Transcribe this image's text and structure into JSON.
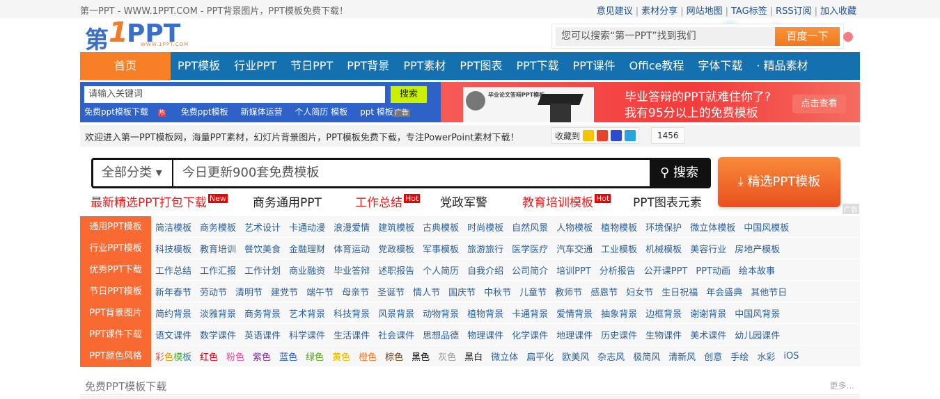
{
  "topbar": {
    "title": "第一PPT - WWW.1PPT.COM - PPT背景图片，PPT模板免费下载！",
    "links": [
      "意见建议",
      "素材分享",
      "网站地图",
      "TAG标签",
      "RSS订阅",
      "加入收藏"
    ]
  },
  "logo": {
    "a": "第",
    "b": "1",
    "c": "PPT",
    "url": "WWW.1PPT.COM"
  },
  "baidu": {
    "placeholder": "您可以搜索“第一PPT”找到我们",
    "button": "百度一下"
  },
  "nav": [
    "首页",
    "PPT模板",
    "行业PPT",
    "节日PPT",
    "PPT背景",
    "PPT素材",
    "PPT图表",
    "PPT下载",
    "PPT课件",
    "Office教程",
    "字体下载",
    "· 精品素材"
  ],
  "quick": {
    "placeholder": "请输入关键词",
    "button": "搜索",
    "links": [
      "免费ppt模板下载",
      "免费ppt模板",
      "新媒体运营",
      "个人简历 模板",
      "ppt 模板"
    ],
    "hot": "热",
    "ad": "广告"
  },
  "banner": {
    "card_title": "毕业论文答辩PPT模板",
    "line1": "毕业答辩的PPT就难住你了?",
    "line2": "我有95分以上的免费模板",
    "button": "点击查看"
  },
  "welcome": {
    "text": "欢迎进入第一PPT模板网，海量PPT素材，幻灯片背景图片，PPT模板免费下载，专注PowerPoint素材下载！",
    "fav_label": "收藏到",
    "count": "1456"
  },
  "bigsearch": {
    "category": "全部分类 ▾",
    "placeholder": "今日更新900套免费模板",
    "button": "搜索",
    "pick": "精选PPT模板",
    "ad": "广告"
  },
  "hotlinks": [
    {
      "text": "最新精选PPT打包下载",
      "badge": "New",
      "red": true
    },
    {
      "text": "商务通用PPT"
    },
    {
      "text": "工作总结",
      "badge": "Hot",
      "red": true
    },
    {
      "text": "党政军警"
    },
    {
      "text": "教育培训模板",
      "badge": "Hot",
      "red": true
    },
    {
      "text": "PPT图表元素"
    }
  ],
  "categories": [
    {
      "label": "通用PPT模板",
      "items": [
        "简洁模板",
        "商务模板",
        "艺术设计",
        "卡通动漫",
        "浪漫爱情",
        "建筑模板",
        "古典模板",
        "时尚模板",
        "自然风景",
        "人物模板",
        "植物模板",
        "环境保护",
        "微立体模板",
        "中国风模板"
      ]
    },
    {
      "label": "行业PPT模板",
      "items": [
        "科技模板",
        "教育培训",
        "餐饮美食",
        "金融理财",
        "体育运动",
        "党政模板",
        "军事模板",
        "旅游旅行",
        "医学医疗",
        "汽车交通",
        "工业模板",
        "机械模板",
        "美容行业",
        "房地产模板"
      ]
    },
    {
      "label": "优秀PPT下载",
      "items": [
        "工作总结",
        "工作汇报",
        "工作计划",
        "商业融资",
        "毕业答辩",
        "述职报告",
        "个人简历",
        "自我介绍",
        "公司简介",
        "培训PPT",
        "分析报告",
        "公开课PPT",
        "PPT动画",
        "绘本故事"
      ]
    },
    {
      "label": "节日PPT模板",
      "items": [
        "新年春节",
        "劳动节",
        "清明节",
        "建党节",
        "端午节",
        "母亲节",
        "圣诞节",
        "情人节",
        "国庆节",
        "中秋节",
        "儿童节",
        "教师节",
        "感恩节",
        "妇女节",
        "生日祝福",
        "年会盛典",
        "其他节日"
      ]
    },
    {
      "label": "PPT背景图片",
      "items": [
        "简约背景",
        "淡雅背景",
        "商务背景",
        "艺术背景",
        "科技背景",
        "风景背景",
        "动物背景",
        "植物背景",
        "卡通背景",
        "爱情背景",
        "抽象背景",
        "边框背景",
        "谢谢背景",
        "中国风背景"
      ]
    },
    {
      "label": "PPT课件下载",
      "items": [
        "语文课件",
        "数学课件",
        "英语课件",
        "科学课件",
        "生活课件",
        "社会课件",
        "思想品德",
        "物理课件",
        "化学课件",
        "地理课件",
        "历史课件",
        "生物课件",
        "美术课件",
        "幼儿园课件"
      ]
    },
    {
      "label": "PPT颜色风格",
      "items": [
        "彩色模板",
        "红色",
        "粉色",
        "紫色",
        "蓝色",
        "绿色",
        "黄色",
        "橙色",
        "棕色",
        "黑色",
        "灰色",
        "黑白",
        "微立体",
        "扁平化",
        "欧美风",
        "杂志风",
        "极简风",
        "清新风",
        "创意",
        "手绘",
        "水彩",
        "iOS"
      ],
      "colors": [
        "#e8a000",
        "#d0021b",
        "#e0509a",
        "#7b2d9b",
        "#1f5bbf",
        "#5aa01c",
        "#e6b800",
        "#f0782a",
        "#6b3a12",
        "#000000",
        "#999999",
        "#222222"
      ]
    }
  ],
  "section": {
    "title": "免费PPT模板下载",
    "more": "更多..."
  }
}
